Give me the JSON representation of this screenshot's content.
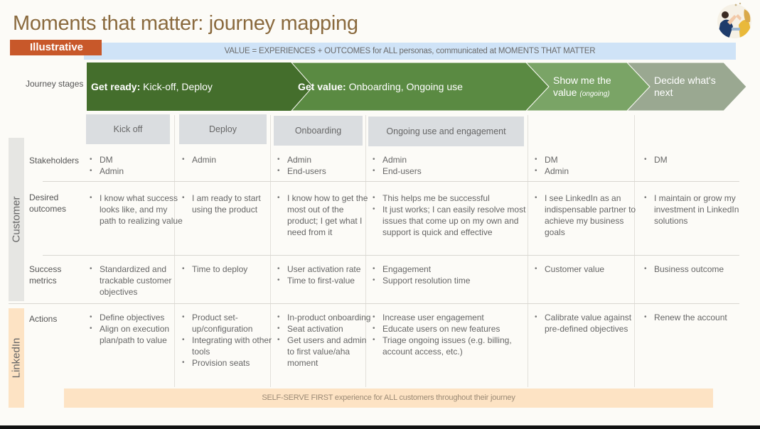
{
  "title": "Moments that matter: journey mapping",
  "badge": "Illustrative",
  "value_banner": "VALUE = EXPERIENCES + OUTCOMES for ALL personas, communicated at MOMENTS THAT MATTER",
  "illustration": "people-high-five-illustration",
  "row_labels": {
    "journey_stages": "Journey stages",
    "stakeholders": "Stakeholders",
    "desired_outcomes": "Desired outcomes",
    "success_metrics": "Success metrics",
    "actions": "Actions"
  },
  "groups": {
    "customer": "Customer",
    "linkedin": "LinkedIn"
  },
  "stages": [
    {
      "bold": "Get ready:",
      "rest": " Kick-off, Deploy",
      "color": "#446e2c"
    },
    {
      "bold": "Get value:",
      "rest": " Onboarding, Ongoing use",
      "color": "#5a8a42"
    },
    {
      "bold": "Show me the value",
      "rest": "(ongoing)",
      "color": "#7aa466"
    },
    {
      "bold": "Decide what's next",
      "rest": "",
      "color": "#9aa891"
    }
  ],
  "substages": [
    "Kick off",
    "Deploy",
    "Onboarding",
    "Ongoing use and engagement"
  ],
  "columns": [
    {
      "stakeholders": [
        "DM",
        "Admin"
      ],
      "desired_outcomes": [
        "I know what success looks like, and my path to realizing value"
      ],
      "success_metrics": [
        "Standardized and trackable customer objectives"
      ],
      "actions": [
        "Define objectives",
        "Align on execution plan/path to value"
      ]
    },
    {
      "stakeholders": [
        "Admin"
      ],
      "desired_outcomes": [
        "I am ready to start using the product"
      ],
      "success_metrics": [
        "Time to deploy"
      ],
      "actions": [
        "Product set-up/configuration",
        "Integrating with other tools",
        "Provision seats"
      ]
    },
    {
      "stakeholders": [
        "Admin",
        "End-users"
      ],
      "desired_outcomes": [
        "I know how to get the most out of the product; I get what I need from it"
      ],
      "success_metrics": [
        "User activation rate",
        "Time to first-value"
      ],
      "actions": [
        "In-product onboarding",
        "Seat activation",
        "Get users and admin to first value/aha moment"
      ]
    },
    {
      "stakeholders": [
        "Admin",
        "End-users"
      ],
      "desired_outcomes": [
        "This helps me be successful",
        "It just works; I can easily resolve most issues that come up on my own and support is quick and effective"
      ],
      "success_metrics": [
        "Engagement",
        "Support resolution time"
      ],
      "actions": [
        "Increase user engagement",
        "Educate users on new features",
        "Triage ongoing issues (e.g. billing, account access, etc.)"
      ]
    },
    {
      "stakeholders": [
        "DM",
        "Admin"
      ],
      "desired_outcomes": [
        "I see LinkedIn as an indispensable partner to achieve my business goals"
      ],
      "success_metrics": [
        "Customer value"
      ],
      "actions": [
        "Calibrate value against pre-defined objectives"
      ]
    },
    {
      "stakeholders": [
        "DM"
      ],
      "desired_outcomes": [
        "I maintain or grow my investment in LinkedIn solutions"
      ],
      "success_metrics": [
        "Business outcome"
      ],
      "actions": [
        "Renew the account"
      ]
    }
  ],
  "self_serve_banner": "SELF-SERVE FIRST experience for ALL customers throughout their journey"
}
